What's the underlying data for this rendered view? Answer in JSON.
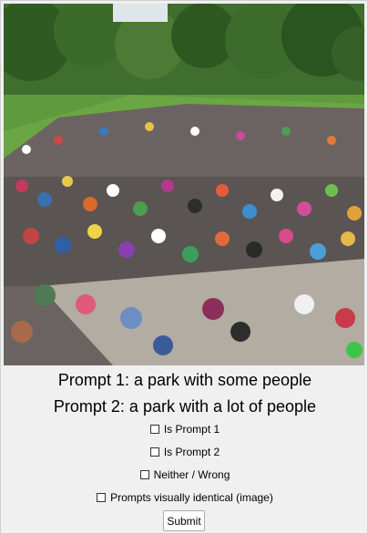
{
  "prompts": {
    "prompt1": "Prompt 1: a park with some people",
    "prompt2": "Prompt 2: a park with a lot of people"
  },
  "options": {
    "is_prompt_1": "Is Prompt 1",
    "is_prompt_2": "Is Prompt 2",
    "neither": "Neither / Wrong",
    "identical": "Prompts visually identical (image)"
  },
  "submit_label": "Submit"
}
